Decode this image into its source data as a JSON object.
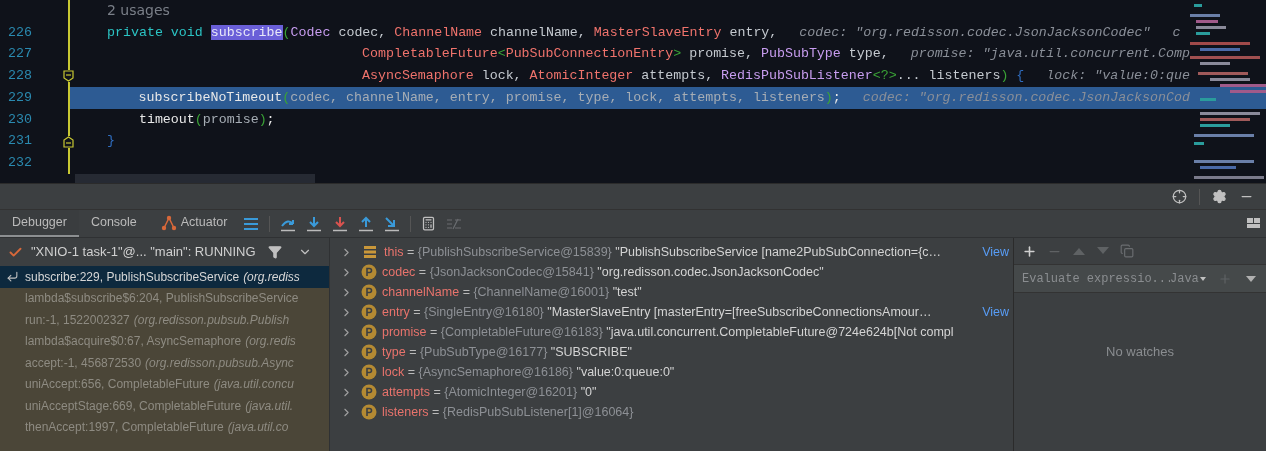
{
  "editor": {
    "usages": "2 usages",
    "lines": [
      {
        "number": "226",
        "selected": false,
        "kind": "plain",
        "tokens": [
          {
            "kind": "kw",
            "text": "private void "
          },
          {
            "kind": "decl",
            "text": "subscribe"
          },
          {
            "kind": "paren",
            "text": "("
          },
          {
            "kind": "iface",
            "text": "Codec"
          },
          {
            "kind": "ident",
            "text": " codec, "
          },
          {
            "kind": "class",
            "text": "ChannelName"
          },
          {
            "kind": "ident",
            "text": " channelName, "
          },
          {
            "kind": "class",
            "text": "MasterSlaveEntry"
          },
          {
            "kind": "ident",
            "text": " entry,"
          }
        ],
        "hints": [
          "codec: \"org.redisson.codec.JsonJacksonCodec\"",
          "c"
        ]
      },
      {
        "number": "227",
        "selected": false,
        "kind": "plain",
        "tokens": [
          {
            "kind": "class",
            "text": "                                CompletableFuture"
          },
          {
            "kind": "paren",
            "text": "<"
          },
          {
            "kind": "class",
            "text": "PubSubConnectionEntry"
          },
          {
            "kind": "paren",
            "text": ">"
          },
          {
            "kind": "ident",
            "text": " promise, "
          },
          {
            "kind": "iface",
            "text": "PubSubType"
          },
          {
            "kind": "ident",
            "text": " type,"
          }
        ],
        "hints": [
          "promise: \"java.util.concurrent.Comp"
        ]
      },
      {
        "number": "228",
        "selected": false,
        "kind": "fold-start",
        "tokens": [
          {
            "kind": "class",
            "text": "                                AsyncSemaphore"
          },
          {
            "kind": "ident",
            "text": " lock, "
          },
          {
            "kind": "class",
            "text": "AtomicInteger"
          },
          {
            "kind": "ident",
            "text": " attempts, "
          },
          {
            "kind": "iface",
            "text": "RedisPubSubListener"
          },
          {
            "kind": "paren",
            "text": "<?>"
          },
          {
            "kind": "ident",
            "text": "... listeners"
          },
          {
            "kind": "paren",
            "text": ")"
          },
          {
            "kind": "brace",
            "text": " {"
          }
        ],
        "hints": [
          "lock: \"value:0:que"
        ]
      },
      {
        "number": "229",
        "selected": true,
        "kind": "plain",
        "tokens": [
          {
            "kind": "plain",
            "text": "    subscribeNoTimeout"
          },
          {
            "kind": "paren",
            "text": "("
          },
          {
            "kind": "arg",
            "text": "codec, channelName, entry, promise, type, lock, attempts, listeners"
          },
          {
            "kind": "paren",
            "text": ")"
          },
          {
            "kind": "plain",
            "text": ";"
          }
        ],
        "hints": [
          "codec: \"org.redisson.codec.JsonJacksonCod"
        ]
      },
      {
        "number": "230",
        "selected": false,
        "kind": "plain",
        "tokens": [
          {
            "kind": "plain",
            "text": "    timeout"
          },
          {
            "kind": "paren",
            "text": "("
          },
          {
            "kind": "arg",
            "text": "promise"
          },
          {
            "kind": "paren",
            "text": ")"
          },
          {
            "kind": "plain",
            "text": ";"
          }
        ]
      },
      {
        "number": "231",
        "selected": false,
        "kind": "fold-end",
        "tokens": [
          {
            "kind": "brace",
            "text": "}"
          }
        ]
      },
      {
        "number": "232",
        "selected": false,
        "kind": "plain"
      }
    ]
  },
  "debug_panel": {
    "tabs": [
      {
        "label": "Debugger",
        "selected": true
      },
      {
        "label": "Console",
        "selected": false
      },
      {
        "label": "Actuator",
        "selected": false
      }
    ],
    "thread": "\"XNIO-1 task-1\"@... \"main\": RUNNING",
    "frames": [
      {
        "location": "subscribe:229, PublishSubscribeService",
        "package": "(org.rediss",
        "selected": true
      },
      {
        "location": "lambda$subscribe$6:204, PublishSubscribeService",
        "selected": false
      },
      {
        "location": "run:-1, 1522002327",
        "package": "(org.redisson.pubsub.Publish",
        "selected": false
      },
      {
        "location": "lambda$acquire$0:67, AsyncSemaphore",
        "package": "(org.redis",
        "selected": false
      },
      {
        "location": "accept:-1, 456872530",
        "package": "(org.redisson.pubsub.Async",
        "selected": false
      },
      {
        "location": "uniAccept:656, CompletableFuture",
        "package": "(java.util.concu",
        "selected": false
      },
      {
        "location": "uniAcceptStage:669, CompletableFuture",
        "package": "(java.util.",
        "selected": false
      },
      {
        "location": "thenAccept:1997, CompletableFuture",
        "package": "(java.util.co",
        "selected": false
      }
    ],
    "variables": [
      {
        "kind": "object",
        "name": "this",
        "eq": "=",
        "type": "{PublishSubscribeService@15839}",
        "value": "\"PublishSubscribeService [name2PubSubConnection={c…",
        "link": "View"
      },
      {
        "kind": "param",
        "name": "codec",
        "eq": "=",
        "type": "{JsonJacksonCodec@15841}",
        "value": "\"org.redisson.codec.JsonJacksonCodec\""
      },
      {
        "kind": "param",
        "name": "channelName",
        "eq": "=",
        "type": "{ChannelName@16001}",
        "value": "\"test\""
      },
      {
        "kind": "param",
        "name": "entry",
        "eq": "=",
        "type": "{SingleEntry@16180}",
        "value": "\"MasterSlaveEntry [masterEntry=[freeSubscribeConnectionsAmour…",
        "link": "View"
      },
      {
        "kind": "param",
        "name": "promise",
        "eq": "=",
        "type": "{CompletableFuture@16183}",
        "value": "\"java.util.concurrent.CompletableFuture@724e624b[Not compl"
      },
      {
        "kind": "param",
        "name": "type",
        "eq": "=",
        "type": "{PubSubType@16177}",
        "value": "\"SUBSCRIBE\""
      },
      {
        "kind": "param",
        "name": "lock",
        "eq": "=",
        "type": "{AsyncSemaphore@16186}",
        "value": "\"value:0:queue:0\""
      },
      {
        "kind": "param",
        "name": "attempts",
        "eq": "=",
        "type": "{AtomicInteger@16201}",
        "value": "\"0\""
      },
      {
        "kind": "param",
        "name": "listeners",
        "eq": "=",
        "type": "{RedisPubSubListener[1]@16064}"
      }
    ],
    "watches": {
      "placeholder": "Evaluate expressio...",
      "language": "Java",
      "empty": "No watches"
    }
  }
}
